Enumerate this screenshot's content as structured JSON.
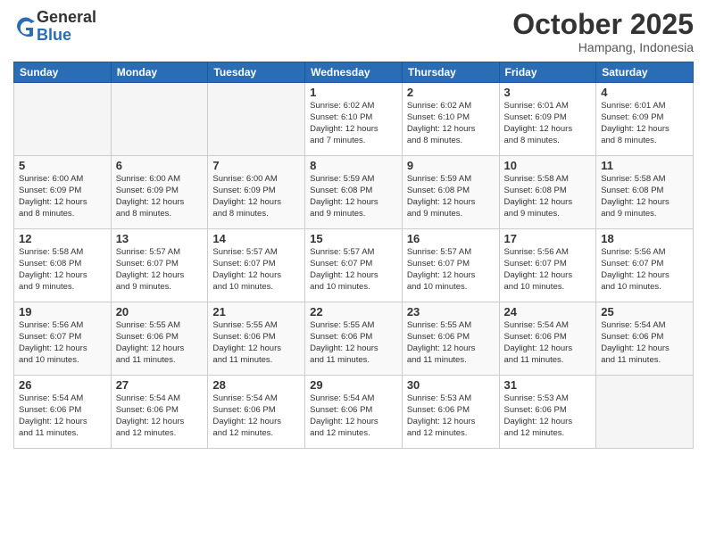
{
  "logo": {
    "general": "General",
    "blue": "Blue"
  },
  "header": {
    "month": "October 2025",
    "location": "Hampang, Indonesia"
  },
  "weekdays": [
    "Sunday",
    "Monday",
    "Tuesday",
    "Wednesday",
    "Thursday",
    "Friday",
    "Saturday"
  ],
  "weeks": [
    [
      {
        "day": "",
        "info": ""
      },
      {
        "day": "",
        "info": ""
      },
      {
        "day": "",
        "info": ""
      },
      {
        "day": "1",
        "info": "Sunrise: 6:02 AM\nSunset: 6:10 PM\nDaylight: 12 hours\nand 7 minutes."
      },
      {
        "day": "2",
        "info": "Sunrise: 6:02 AM\nSunset: 6:10 PM\nDaylight: 12 hours\nand 8 minutes."
      },
      {
        "day": "3",
        "info": "Sunrise: 6:01 AM\nSunset: 6:09 PM\nDaylight: 12 hours\nand 8 minutes."
      },
      {
        "day": "4",
        "info": "Sunrise: 6:01 AM\nSunset: 6:09 PM\nDaylight: 12 hours\nand 8 minutes."
      }
    ],
    [
      {
        "day": "5",
        "info": "Sunrise: 6:00 AM\nSunset: 6:09 PM\nDaylight: 12 hours\nand 8 minutes."
      },
      {
        "day": "6",
        "info": "Sunrise: 6:00 AM\nSunset: 6:09 PM\nDaylight: 12 hours\nand 8 minutes."
      },
      {
        "day": "7",
        "info": "Sunrise: 6:00 AM\nSunset: 6:09 PM\nDaylight: 12 hours\nand 8 minutes."
      },
      {
        "day": "8",
        "info": "Sunrise: 5:59 AM\nSunset: 6:08 PM\nDaylight: 12 hours\nand 9 minutes."
      },
      {
        "day": "9",
        "info": "Sunrise: 5:59 AM\nSunset: 6:08 PM\nDaylight: 12 hours\nand 9 minutes."
      },
      {
        "day": "10",
        "info": "Sunrise: 5:58 AM\nSunset: 6:08 PM\nDaylight: 12 hours\nand 9 minutes."
      },
      {
        "day": "11",
        "info": "Sunrise: 5:58 AM\nSunset: 6:08 PM\nDaylight: 12 hours\nand 9 minutes."
      }
    ],
    [
      {
        "day": "12",
        "info": "Sunrise: 5:58 AM\nSunset: 6:08 PM\nDaylight: 12 hours\nand 9 minutes."
      },
      {
        "day": "13",
        "info": "Sunrise: 5:57 AM\nSunset: 6:07 PM\nDaylight: 12 hours\nand 9 minutes."
      },
      {
        "day": "14",
        "info": "Sunrise: 5:57 AM\nSunset: 6:07 PM\nDaylight: 12 hours\nand 10 minutes."
      },
      {
        "day": "15",
        "info": "Sunrise: 5:57 AM\nSunset: 6:07 PM\nDaylight: 12 hours\nand 10 minutes."
      },
      {
        "day": "16",
        "info": "Sunrise: 5:57 AM\nSunset: 6:07 PM\nDaylight: 12 hours\nand 10 minutes."
      },
      {
        "day": "17",
        "info": "Sunrise: 5:56 AM\nSunset: 6:07 PM\nDaylight: 12 hours\nand 10 minutes."
      },
      {
        "day": "18",
        "info": "Sunrise: 5:56 AM\nSunset: 6:07 PM\nDaylight: 12 hours\nand 10 minutes."
      }
    ],
    [
      {
        "day": "19",
        "info": "Sunrise: 5:56 AM\nSunset: 6:07 PM\nDaylight: 12 hours\nand 10 minutes."
      },
      {
        "day": "20",
        "info": "Sunrise: 5:55 AM\nSunset: 6:06 PM\nDaylight: 12 hours\nand 11 minutes."
      },
      {
        "day": "21",
        "info": "Sunrise: 5:55 AM\nSunset: 6:06 PM\nDaylight: 12 hours\nand 11 minutes."
      },
      {
        "day": "22",
        "info": "Sunrise: 5:55 AM\nSunset: 6:06 PM\nDaylight: 12 hours\nand 11 minutes."
      },
      {
        "day": "23",
        "info": "Sunrise: 5:55 AM\nSunset: 6:06 PM\nDaylight: 12 hours\nand 11 minutes."
      },
      {
        "day": "24",
        "info": "Sunrise: 5:54 AM\nSunset: 6:06 PM\nDaylight: 12 hours\nand 11 minutes."
      },
      {
        "day": "25",
        "info": "Sunrise: 5:54 AM\nSunset: 6:06 PM\nDaylight: 12 hours\nand 11 minutes."
      }
    ],
    [
      {
        "day": "26",
        "info": "Sunrise: 5:54 AM\nSunset: 6:06 PM\nDaylight: 12 hours\nand 11 minutes."
      },
      {
        "day": "27",
        "info": "Sunrise: 5:54 AM\nSunset: 6:06 PM\nDaylight: 12 hours\nand 12 minutes."
      },
      {
        "day": "28",
        "info": "Sunrise: 5:54 AM\nSunset: 6:06 PM\nDaylight: 12 hours\nand 12 minutes."
      },
      {
        "day": "29",
        "info": "Sunrise: 5:54 AM\nSunset: 6:06 PM\nDaylight: 12 hours\nand 12 minutes."
      },
      {
        "day": "30",
        "info": "Sunrise: 5:53 AM\nSunset: 6:06 PM\nDaylight: 12 hours\nand 12 minutes."
      },
      {
        "day": "31",
        "info": "Sunrise: 5:53 AM\nSunset: 6:06 PM\nDaylight: 12 hours\nand 12 minutes."
      },
      {
        "day": "",
        "info": ""
      }
    ]
  ]
}
